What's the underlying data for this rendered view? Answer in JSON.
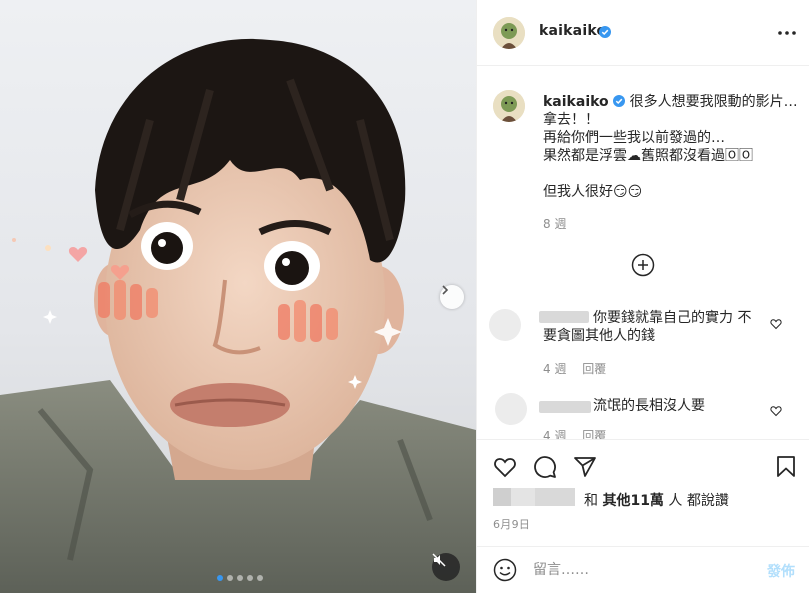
{
  "post": {
    "username": "kaikaiko",
    "verified": true,
    "more_icon": "more-horizontal-icon",
    "carousel": {
      "total_slides": 5,
      "active_slide": 1
    }
  },
  "caption": {
    "username": "kaikaiko",
    "lines": [
      "很多人想要我限動的影片…",
      "拿去！！",
      "再給你們一些我以前發過的…",
      "果然都是浮雲☁舊照都沒看過🄾🄾"
    ],
    "tail": "但我人很好😏😏",
    "time": "8 週"
  },
  "comments": [
    {
      "text_line1": "你要錢就靠自己的實力 不",
      "text_line2": "要貪圖其他人的錢",
      "time": "4 週",
      "reply": "回覆"
    },
    {
      "text_line1": "流氓的長相沒人要",
      "time": "4 週",
      "reply": "回覆"
    }
  ],
  "likes": {
    "prefix": "和",
    "others": "其他",
    "count": "11萬",
    "suffix": "人 都說讚"
  },
  "date": "6月9日",
  "comment_box": {
    "placeholder": "留言……",
    "post_label": "發佈"
  },
  "colors": {
    "verified": "#3897f0",
    "post_button": "#b2dffc",
    "muted": "#8e8e8e"
  }
}
